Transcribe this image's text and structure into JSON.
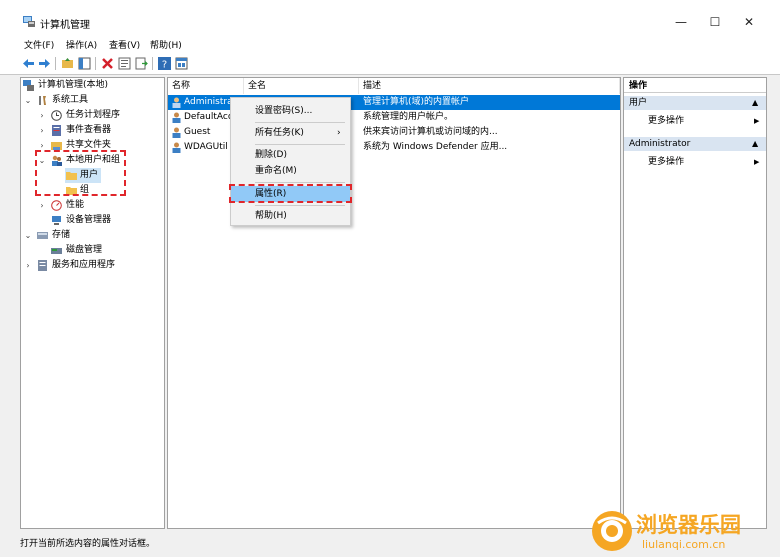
{
  "window": {
    "title": "计算机管理",
    "min_glyph": "—",
    "max_glyph": "☐",
    "close_glyph": "✕"
  },
  "menu": [
    "文件(F)",
    "操作(A)",
    "查看(V)",
    "帮助(H)"
  ],
  "tree": {
    "root": "计算机管理(本地)",
    "system_tools": "系统工具",
    "task_scheduler": "任务计划程序",
    "event_viewer": "事件查看器",
    "shared_folders": "共享文件夹",
    "local_users_groups": "本地用户和组",
    "users": "用户",
    "groups": "组",
    "performance": "性能",
    "device_manager": "设备管理器",
    "storage": "存储",
    "disk_management": "磁盘管理",
    "services_apps": "服务和应用程序"
  },
  "columns": [
    "名称",
    "全名",
    "描述"
  ],
  "rows": [
    {
      "name": "Administra",
      "fullname": "",
      "desc": "管理计算机(域)的内置帐户"
    },
    {
      "name": "DefaultAcc",
      "fullname": "",
      "desc": "系统管理的用户帐户。"
    },
    {
      "name": "Guest",
      "fullname": "",
      "desc": "供来宾访问计算机或访问域的内..."
    },
    {
      "name": "WDAGUtil",
      "fullname": "",
      "desc": "系统为 Windows Defender 应用..."
    }
  ],
  "context_menu": {
    "set_password": "设置密码(S)...",
    "all_tasks": "所有任务(K)",
    "all_tasks_arrow": "›",
    "delete": "删除(D)",
    "rename": "重命名(M)",
    "properties": "属性(R)",
    "help": "帮助(H)"
  },
  "actions": {
    "header": "操作",
    "group1": "用户",
    "more1": "更多操作",
    "group2": "Administrator",
    "more2": "更多操作",
    "collapse_glyph": "▲",
    "submenu_glyph": "▶"
  },
  "status": "打开当前所选内容的属性对话框。",
  "watermark": {
    "title": "浏览器乐园",
    "url": "liulanqi.com.cn"
  },
  "colors": {
    "selection": "#0078d7",
    "highlight_dash": "#e0262b",
    "action_group_bg": "#d9e4f1",
    "watermark_orange": "#f5a623"
  }
}
